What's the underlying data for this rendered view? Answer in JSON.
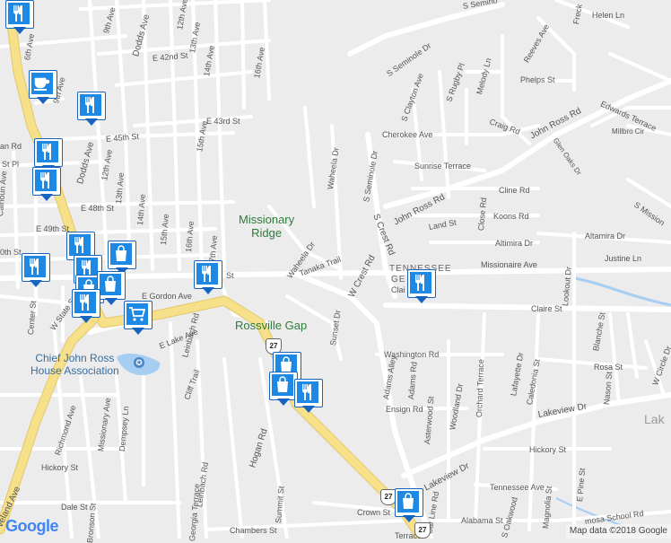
{
  "map": {
    "colors": {
      "land": "#ececec",
      "road": "#ffffff",
      "highway": "#f6e089",
      "water": "#a6cdf2",
      "park_text": "#2e7d3a",
      "marker": "#1e88e5"
    }
  },
  "place_labels": {
    "missionary_ridge": "Missionary\nRidge",
    "rossville_gap": "Rossville Gap",
    "chief_john_ross": "Chief John Ross\nHouse Association",
    "tennessee": "TENNESSEE",
    "georgia_abbrev": "GE",
    "lake_fragment": "Lak"
  },
  "route_shield": "27",
  "streets": {
    "s_seminole_dr_top": "S Seminole Dr",
    "s_seminole_dr": "S Seminole Dr",
    "s_seminole_dr_v": "S Seminole Dr",
    "john_ross_rd": "John Ross Rd",
    "john_ross_rd_2": "John Ross Rd",
    "edwards_terrace": "Edwards Terrace",
    "cherokee_ave": "Cherokee Ave",
    "sunrise_terrace": "Sunrise Terrace",
    "cline_rd": "Cline Rd",
    "koons_rd": "Koons Rd",
    "altimira_dr": "Altimira Dr",
    "altamira_dr": "Altamira Dr",
    "missionaire_ave": "Missionaire Ave",
    "justine_ln": "Justine Ln",
    "claire_st": "Claire St",
    "claire_frag": "Clai",
    "washington_rd": "Washington Rd",
    "ensign_rd": "Ensign Rd",
    "lakeview_dr": "Lakeview Dr",
    "lakeview_dr_2": "Lakeview Dr",
    "hickory_st": "Hickory St",
    "tennessee_ave": "Tennessee Ave",
    "rosa_st": "Rosa St",
    "alabama_st": "Alabama St",
    "crown_st": "Crown St",
    "chambers_st": "Chambers St",
    "dale_st": "Dale St",
    "hickory_st_w": "Hickory St",
    "hogan_rd": "Hogan Rd",
    "car_line_rd": "Car Line Rd",
    "w_crest_rd": "W Crest Rd",
    "s_crest_rd": "S Crest Rd",
    "e_gordon_ave": "E Gordon Ave",
    "e_lake_ave": "E Lake Ave",
    "tanaka_trail": "Tanaka Trail",
    "waheela_dr": "Waheela Dr",
    "waheela_dr_2": "Waheela Dr",
    "sunset_dr": "Sunset Dr",
    "dodds_ave": "Dodds Ave",
    "dodds_ave_2": "Dodds Ave",
    "e_42nd_st": "E 42nd St",
    "e_43rd_st": "E 43rd St",
    "e_45th_st": "E 45th St",
    "e_48th_st": "E 48th St",
    "e_49th_st": "E 49th St",
    "st_pl": "St Pl",
    "an_rd": "an Rd",
    "th_st_frag": "0th St",
    "st_frag": "St",
    "calhoun_ave": "Calhoun Ave",
    "center_st": "Center St",
    "w_state_st": "W State St",
    "leinbach_rd": "Leinbach Rd",
    "leinbach_rd_2": "Leinbach Rd",
    "cliff_trail": "Cliff Trail",
    "richmond_ave": "Richmond Ave",
    "missionary_ave": "Missionary Ave",
    "dempsey_ln": "Dempsey Ln",
    "georgia_terrace": "Georgia Terrace",
    "summit_st": "Summit St",
    "bronson_st": "Bronson St",
    "cleveland_ave": "veland Ave",
    "sixth_ave": "6th Ave",
    "ninth_ave": "9th Ave",
    "ninth_ave_2": "9th Ave",
    "twelfth_ave": "12th Ave",
    "twelfth_ave_2": "12th Ave",
    "thirteenth_ave": "13th Ave",
    "thirteenth_ave_2": "13th Ave",
    "fourteenth_ave": "14th Ave",
    "fourteenth_ave_2": "14th Ave",
    "fifteenth_ave": "15th Ave",
    "fifteenth_ave_2": "15th Ave",
    "sixteenth_ave": "16th Ave",
    "sixteenth_ave_2": "16th Ave",
    "seventeenth_ave": "17th Ave",
    "clayton_ave": "S Clayton Ave",
    "rugby_pl": "S Rugby Pl",
    "melody_ln": "Melody Ln",
    "reeves_ave": "Reeves Ave",
    "phelps_st": "Phelps St",
    "craig_rd": "Craig Rd",
    "millbro_cir": "Millbro Cir",
    "glen_oaks_dr": "Glen Oaks Dr",
    "helen_ln": "Helen Ln",
    "close_rd": "Close Rd",
    "lookout_dr": "Lookout Dr",
    "blanche_st": "Blanche St",
    "w_circle_dr": "W Circle Dr",
    "nason_st": "Nason St",
    "e_pine_st": "E Pine St",
    "magnolia_st": "Magnolia St",
    "orchard_terrace": "Orchard Terrace",
    "woodland_dr": "Woodland Dr",
    "asterwood_st": "Asterwood St",
    "adams_alley": "Adams Alley",
    "adams_rd": "Adams Rd",
    "lafayette_dr": "Lafayette Dr",
    "caledonia_st": "Caledonia St",
    "s_oakwood": "S Oakwood",
    "rosa_school_rd": "mosa School Rd",
    "s_mission": "S Mission",
    "freck": "Freck",
    "s_seminole_top_frag": "S Semino",
    "eland_st": "Land St",
    "terrace": "Terrace"
  },
  "attribution": "Map data ©2018 Google",
  "logo": "Google",
  "markers": [
    {
      "type": "restaurant",
      "icon": "fork-knife-icon"
    },
    {
      "type": "cafe",
      "icon": "coffee-cup-icon"
    },
    {
      "type": "restaurant",
      "icon": "fork-knife-icon"
    },
    {
      "type": "restaurant",
      "icon": "fork-knife-icon"
    },
    {
      "type": "restaurant",
      "icon": "fork-knife-icon"
    },
    {
      "type": "restaurant",
      "icon": "fork-knife-icon"
    },
    {
      "type": "shopping",
      "icon": "shopping-bag-icon"
    },
    {
      "type": "restaurant",
      "icon": "fork-knife-icon"
    },
    {
      "type": "restaurant",
      "icon": "fork-knife-icon"
    },
    {
      "type": "shopping",
      "icon": "shopping-bag-icon"
    },
    {
      "type": "shopping",
      "icon": "shopping-bag-icon"
    },
    {
      "type": "restaurant",
      "icon": "fork-knife-icon"
    },
    {
      "type": "grocery",
      "icon": "shopping-cart-icon"
    },
    {
      "type": "restaurant",
      "icon": "fork-knife-icon"
    },
    {
      "type": "restaurant",
      "icon": "fork-knife-icon"
    },
    {
      "type": "shopping",
      "icon": "shopping-bag-icon"
    },
    {
      "type": "shopping",
      "icon": "shopping-bag-icon"
    },
    {
      "type": "restaurant",
      "icon": "fork-knife-icon"
    },
    {
      "type": "shopping",
      "icon": "shopping-bag-icon"
    }
  ]
}
